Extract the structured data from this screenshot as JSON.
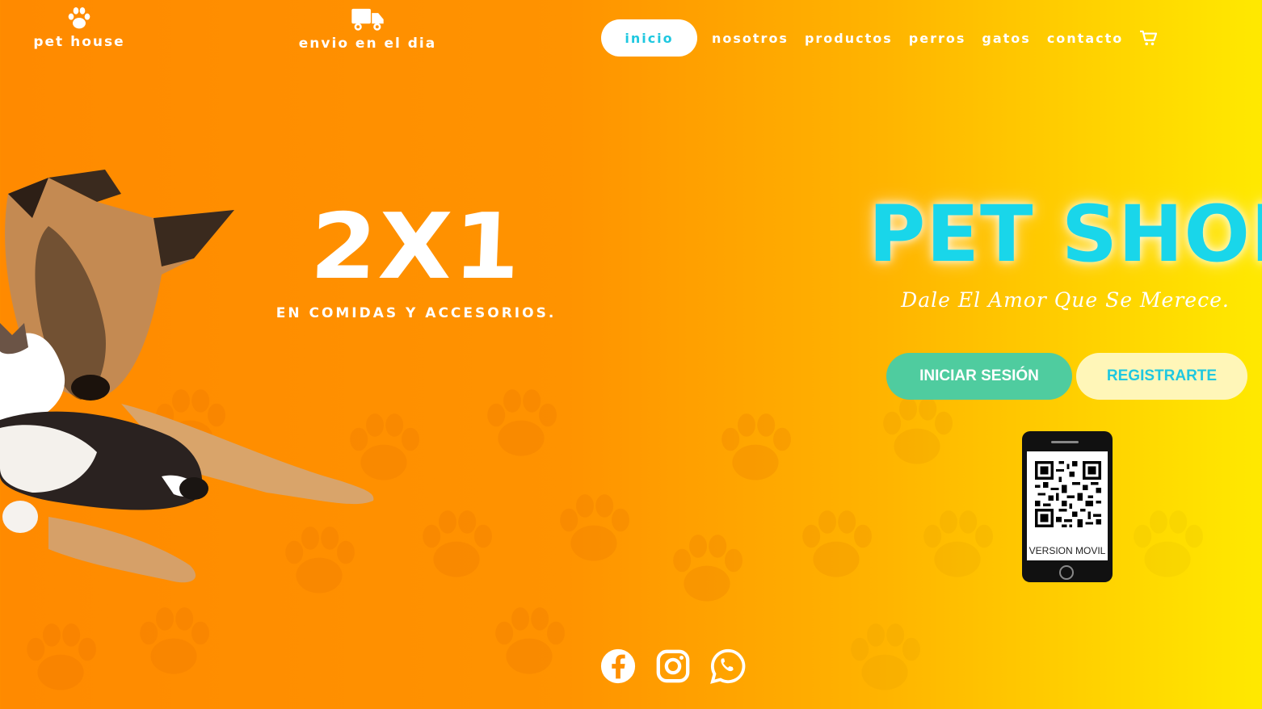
{
  "brand": {
    "left_label": "Pet House",
    "left_icon": "paw-icon",
    "center_label": "Envio en el dia",
    "center_icon": "truck-icon"
  },
  "nav": {
    "items": [
      {
        "label": "Inicio",
        "active": true
      },
      {
        "label": "Nosotros"
      },
      {
        "label": "Productos"
      },
      {
        "label": "Perros"
      },
      {
        "label": "Gatos"
      },
      {
        "label": "Contacto"
      }
    ],
    "cart_icon": "cart-icon"
  },
  "promo": {
    "headline": "2X1",
    "subline": "EN COMIDAS Y ACCESORIOS."
  },
  "hero": {
    "title": "PET SHOP",
    "tagline": "Dale El Amor Que Se Merece."
  },
  "buttons": {
    "login": "INICIAR SESIÓN",
    "register": "REGISTRARTE"
  },
  "qr": {
    "caption": "VERSION MOVIL"
  },
  "social": [
    "facebook-icon",
    "instagram-icon",
    "whatsapp-icon"
  ],
  "colors": {
    "accent_cyan": "#19d6ea",
    "login_green": "#4fcc9f",
    "register_cream": "#fff6b8",
    "bg_orange": "#ff8a00",
    "bg_yellow": "#ffe900"
  }
}
